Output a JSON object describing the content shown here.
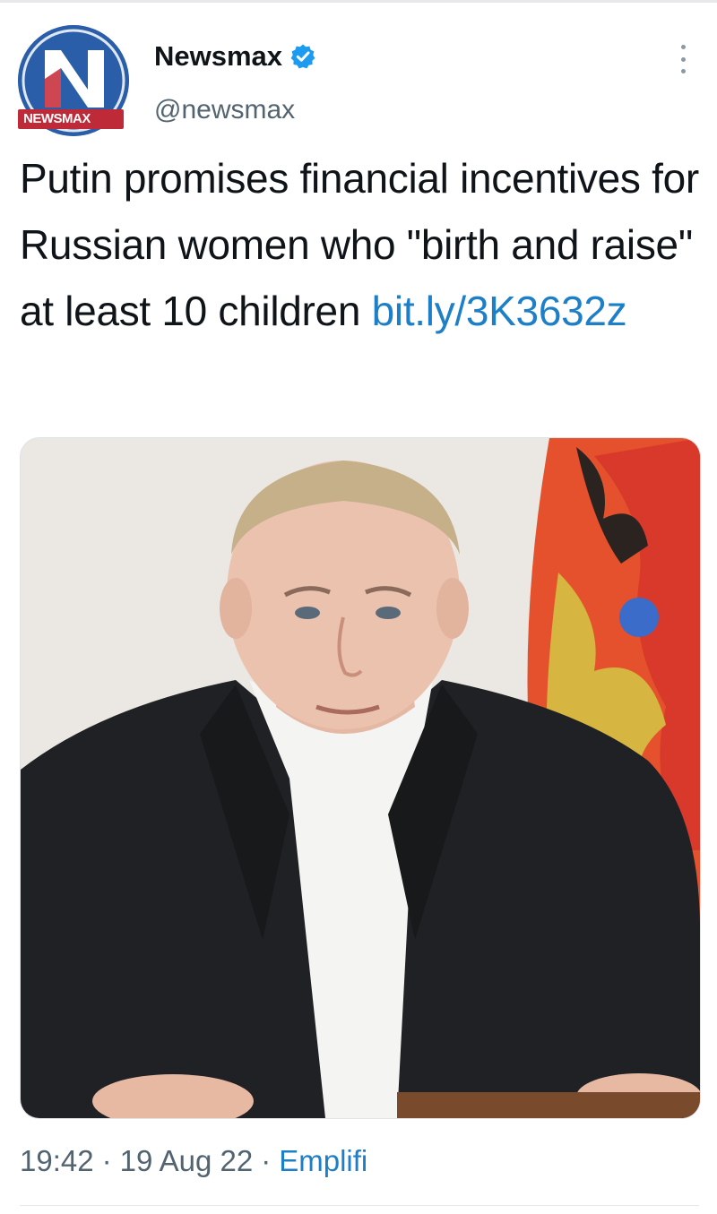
{
  "tweet": {
    "display_name": "Newsmax",
    "handle": "@newsmax",
    "avatar_label": "NEWSMAX",
    "avatar_letter": "N",
    "text": "Putin promises financial incentives for Russian women who \"birth and raise\" at least 10 children",
    "link": "bit.ly/3K3632z",
    "time": "19:42",
    "date": "19 Aug 22",
    "source": "Emplifi"
  },
  "icons": {
    "verified": "verified-badge-icon",
    "more": "more-options-icon"
  },
  "colors": {
    "link": "#1d7fc7",
    "secondary_text": "#536471",
    "verified": "#1d9bf0",
    "avatar_blue": "#2a5ea8",
    "avatar_red": "#bf2a38"
  }
}
